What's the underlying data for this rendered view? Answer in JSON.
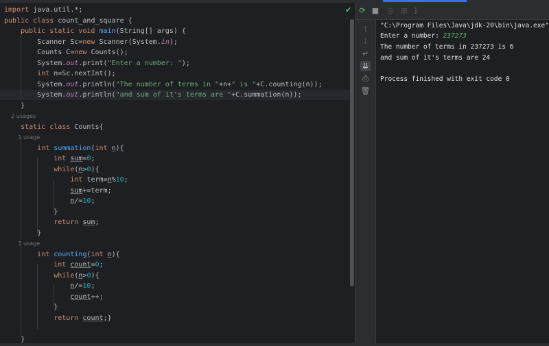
{
  "editor": {
    "lines": [
      [
        [
          "import java.util.*;",
          "kw-import"
        ]
      ],
      [
        [
          "public class ",
          "kw"
        ],
        [
          "count_and_square {",
          ""
        ]
      ],
      [
        [
          "    public static void ",
          "kw"
        ],
        [
          "main",
          "fn"
        ],
        [
          "(String[] args) {",
          ""
        ]
      ],
      [
        [
          "        Scanner Sc=",
          ""
        ],
        [
          "new ",
          "kw"
        ],
        [
          "Scanner(System.",
          ""
        ],
        [
          "in",
          "st"
        ],
        [
          ");",
          ""
        ]
      ],
      [
        [
          "        Counts C=",
          ""
        ],
        [
          "new ",
          "kw"
        ],
        [
          "Counts();",
          ""
        ]
      ],
      [
        [
          "        System.",
          ""
        ],
        [
          "out",
          "st"
        ],
        [
          ".print(",
          ""
        ],
        [
          "\"Enter a number: \"",
          "str"
        ],
        [
          ");",
          ""
        ]
      ],
      [
        [
          "        ",
          ""
        ],
        [
          "int ",
          "kw"
        ],
        [
          "n=Sc.nextInt();",
          ""
        ]
      ],
      [
        [
          "        System.",
          ""
        ],
        [
          "out",
          "st"
        ],
        [
          ".println(",
          ""
        ],
        [
          "\"The number of terms in \"",
          "str"
        ],
        [
          "+n+",
          ""
        ],
        [
          "\" is \"",
          "str"
        ],
        [
          "+C.counting(n));",
          ""
        ]
      ],
      [
        [
          "        System.",
          ""
        ],
        [
          "out",
          "st"
        ],
        [
          ".println(",
          ""
        ],
        [
          "\"and sum of it's terms are \"",
          "str"
        ],
        [
          "+C.summation(n));",
          ""
        ]
      ],
      [
        [
          "    }",
          ""
        ]
      ],
      [
        [
          "    2 usages",
          "hint"
        ]
      ],
      [
        [
          "    ",
          ""
        ],
        [
          "static class ",
          "kw"
        ],
        [
          "Counts{",
          ""
        ]
      ],
      [
        [
          "        1 usage",
          "hint"
        ]
      ],
      [
        [
          "        ",
          ""
        ],
        [
          "int ",
          "kw"
        ],
        [
          "summation",
          "fn"
        ],
        [
          "(",
          ""
        ],
        [
          "int ",
          "kw"
        ],
        [
          "n",
          "var"
        ],
        [
          "){",
          ""
        ]
      ],
      [
        [
          "            ",
          ""
        ],
        [
          "int ",
          "kw"
        ],
        [
          "sum",
          "var"
        ],
        [
          "=",
          ""
        ],
        [
          "0",
          "num"
        ],
        [
          ";",
          ""
        ]
      ],
      [
        [
          "            ",
          ""
        ],
        [
          "while",
          "kw"
        ],
        [
          "(",
          ""
        ],
        [
          "n",
          "var"
        ],
        [
          ">",
          ""
        ],
        [
          "0",
          "num"
        ],
        [
          "){",
          ""
        ]
      ],
      [
        [
          "                ",
          ""
        ],
        [
          "int ",
          "kw"
        ],
        [
          "term=",
          ""
        ],
        [
          "n",
          "var"
        ],
        [
          "%",
          ""
        ],
        [
          "10",
          "num"
        ],
        [
          ";",
          ""
        ]
      ],
      [
        [
          "                ",
          ""
        ],
        [
          "sum",
          "var"
        ],
        [
          "+=term;",
          ""
        ]
      ],
      [
        [
          "                ",
          ""
        ],
        [
          "n",
          "var"
        ],
        [
          "/=",
          ""
        ],
        [
          "10",
          "num"
        ],
        [
          ";",
          ""
        ]
      ],
      [
        [
          "            }",
          ""
        ]
      ],
      [
        [
          "            ",
          ""
        ],
        [
          "return ",
          "kw"
        ],
        [
          "sum",
          "var"
        ],
        [
          ";",
          ""
        ]
      ],
      [
        [
          "        }",
          ""
        ]
      ],
      [
        [
          "        1 usage",
          "hint"
        ]
      ],
      [
        [
          "        ",
          ""
        ],
        [
          "int ",
          "kw"
        ],
        [
          "counting",
          "fn"
        ],
        [
          "(",
          ""
        ],
        [
          "int ",
          "kw"
        ],
        [
          "n",
          "var"
        ],
        [
          "){",
          ""
        ]
      ],
      [
        [
          "            ",
          ""
        ],
        [
          "int ",
          "kw"
        ],
        [
          "count",
          "var"
        ],
        [
          "=",
          ""
        ],
        [
          "0",
          "num"
        ],
        [
          ";",
          ""
        ]
      ],
      [
        [
          "            ",
          ""
        ],
        [
          "while",
          "kw"
        ],
        [
          "(",
          ""
        ],
        [
          "n",
          "var"
        ],
        [
          ">",
          ""
        ],
        [
          "0",
          "num"
        ],
        [
          "){",
          ""
        ]
      ],
      [
        [
          "                ",
          ""
        ],
        [
          "n",
          "var"
        ],
        [
          "/=",
          ""
        ],
        [
          "10",
          "num"
        ],
        [
          ";",
          ""
        ]
      ],
      [
        [
          "                ",
          ""
        ],
        [
          "count",
          "var"
        ],
        [
          "++;",
          ""
        ]
      ],
      [
        [
          "            }",
          ""
        ]
      ],
      [
        [
          "            ",
          ""
        ],
        [
          "return ",
          "kw"
        ],
        [
          "count",
          "var"
        ],
        [
          ";}",
          ""
        ]
      ],
      [
        [
          "",
          ""
        ]
      ],
      [
        [
          "    }",
          ""
        ]
      ]
    ],
    "current_line_index": 8
  },
  "run_panel": {
    "toolbar_icons": [
      "rerun-icon",
      "stop-icon",
      "screenshot-icon",
      "restore-layout-icon",
      "more-options-icon"
    ],
    "sidebar_icons": [
      "arrow-up-icon",
      "arrow-down-icon",
      "soft-wrap-icon",
      "scroll-to-end-icon",
      "print-icon",
      "delete-icon"
    ],
    "command": "\"C:\\Program Files\\Java\\jdk-20\\bin\\java.exe\"",
    "prompt": "Enter a number: ",
    "input_value": "237273",
    "output_line_1": "The number of terms in 237273 is 6",
    "output_line_2": "and sum of it's terms are 24",
    "exit_message": "Process finished with exit code 0"
  },
  "colors": {
    "keyword": "#cf8e6d",
    "function": "#56a8f5",
    "string": "#6aab73",
    "number": "#2aacb8",
    "static_field": "#c77dbb",
    "hint": "#6f737a",
    "success": "#5fb865",
    "accent": "#3574f0"
  }
}
